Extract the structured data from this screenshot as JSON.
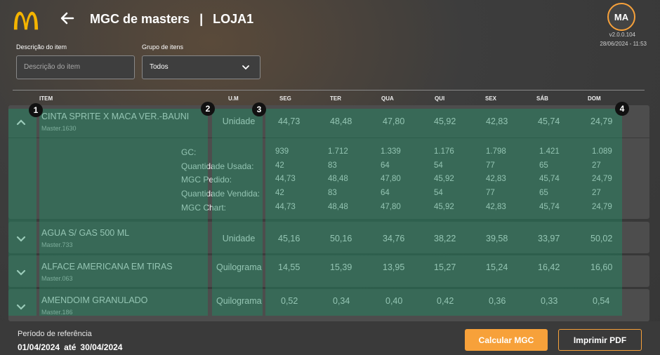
{
  "header": {
    "title": "MGC de masters",
    "store": "LOJA1",
    "separator": "|",
    "avatar_initials": "MA",
    "version": "v2.0.0.104",
    "datetime": "28/06/2024 - 11:53"
  },
  "filters": {
    "description_label": "Descrição do item",
    "description_placeholder": "Descrição do item",
    "group_label": "Grupo de itens",
    "group_value": "Todos"
  },
  "table": {
    "headers": [
      "ITEM",
      "U.M",
      "SEG",
      "TER",
      "QUA",
      "QUI",
      "SEX",
      "SÁB",
      "DOM"
    ],
    "rows": [
      {
        "name": "CINTA SPRITE X MACA VER.-BAUNI",
        "code": "Master.1630",
        "um": "Unidade",
        "values": [
          "44,73",
          "48,48",
          "47,80",
          "45,92",
          "42,83",
          "45,74",
          "24,79"
        ],
        "expanded": true,
        "details": [
          {
            "label": "GC:",
            "values": [
              "939",
              "1.712",
              "1.339",
              "1.176",
              "1.798",
              "1.421",
              "1.089"
            ]
          },
          {
            "label": "Quantidade Usada:",
            "values": [
              "42",
              "83",
              "64",
              "54",
              "77",
              "65",
              "27"
            ]
          },
          {
            "label": "MGC Pedido:",
            "values": [
              "44,73",
              "48,48",
              "47,80",
              "45,92",
              "42,83",
              "45,74",
              "24,79"
            ]
          },
          {
            "label": "Quantidade Vendida:",
            "values": [
              "42",
              "83",
              "64",
              "54",
              "77",
              "65",
              "27"
            ]
          },
          {
            "label": "MGC Chart:",
            "values": [
              "44,73",
              "48,48",
              "47,80",
              "45,92",
              "42,83",
              "45,74",
              "24,79"
            ]
          }
        ]
      },
      {
        "name": "AGUA S/ GAS 500 ML",
        "code": "Master.733",
        "um": "Unidade",
        "values": [
          "45,16",
          "50,16",
          "34,76",
          "38,22",
          "39,58",
          "33,97",
          "50,02"
        ],
        "expanded": false
      },
      {
        "name": "ALFACE AMERICANA EM TIRAS",
        "code": "Master.063",
        "um": "Quilograma",
        "values": [
          "14,55",
          "15,39",
          "13,95",
          "15,27",
          "15,24",
          "16,42",
          "16,60"
        ],
        "expanded": false
      },
      {
        "name": "AMENDOIM GRANULADO",
        "code": "Master.186",
        "um": "Quilograma",
        "values": [
          "0,52",
          "0,34",
          "0,40",
          "0,42",
          "0,36",
          "0,33",
          "0,54"
        ],
        "expanded": false
      }
    ]
  },
  "markers": [
    "1",
    "2",
    "3",
    "4"
  ],
  "footer": {
    "ref_label": "Período de referência",
    "date_from": "01/04/2024",
    "until": "até",
    "date_to": "30/04/2024",
    "calc_button": "Calcular MGC",
    "pdf_button": "Imprimir PDF"
  },
  "colors": {
    "accent": "#f7a13a",
    "overlay": "#1e8c64",
    "logo": "#f4b400"
  },
  "icons": {
    "logo": "mcdonalds-logo",
    "back": "arrow-left-icon",
    "dropdown": "chevron-down-icon",
    "collapse": "chevron-up-icon",
    "expand": "chevron-down-icon"
  }
}
